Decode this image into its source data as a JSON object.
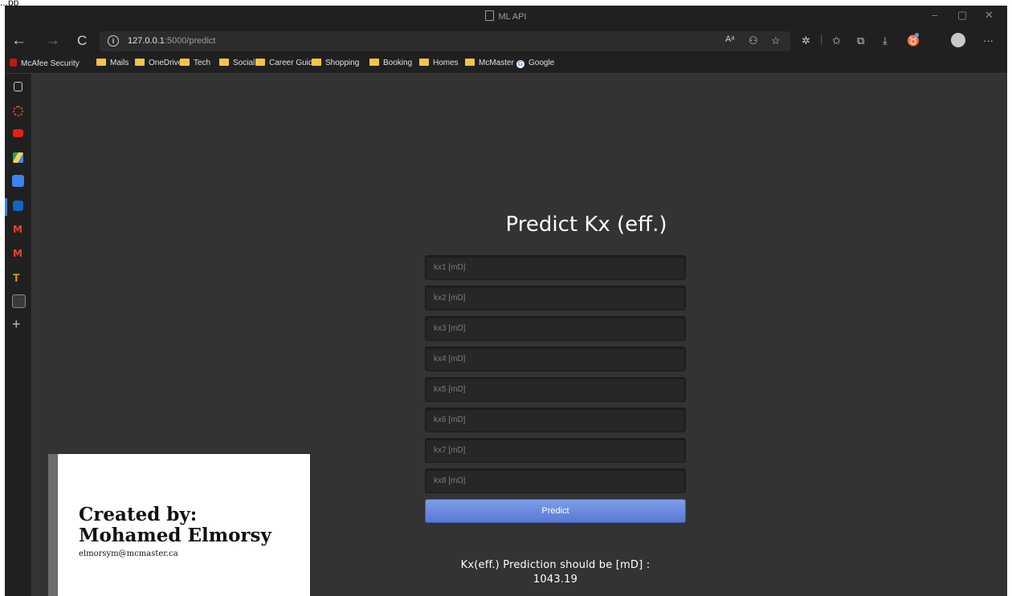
{
  "app_label": "...pp",
  "window": {
    "title": "ML API",
    "minimize": "–",
    "maximize": "▢",
    "close": "✕"
  },
  "toolbar": {
    "back": "←",
    "forward": "→",
    "refresh": "C",
    "info": "i",
    "url_host": "127.0.0.1",
    "url_path": ":5000/predict",
    "read_aloud": "Aᵃ",
    "more": "···"
  },
  "bookmarks": [
    {
      "label": "McAfee Security",
      "icon": "mcafee-icon"
    },
    {
      "label": "Mails",
      "icon": "folder-icon"
    },
    {
      "label": "OneDrive",
      "icon": "folder-icon"
    },
    {
      "label": "Tech",
      "icon": "folder-icon"
    },
    {
      "label": "Social",
      "icon": "folder-icon"
    },
    {
      "label": "Career Guide",
      "icon": "folder-icon"
    },
    {
      "label": "Shopping",
      "icon": "folder-icon"
    },
    {
      "label": "Booking",
      "icon": "folder-icon"
    },
    {
      "label": "Homes",
      "icon": "folder-icon"
    },
    {
      "label": "McMaster",
      "icon": "folder-icon"
    },
    {
      "label": "Google",
      "icon": "google-icon"
    }
  ],
  "sidebar_plus": "+",
  "page": {
    "heading": "Predict Kx (eff.)",
    "fields": [
      {
        "placeholder": "kx1 [mD]"
      },
      {
        "placeholder": "kx2 [mD]"
      },
      {
        "placeholder": "kx3 [mD]"
      },
      {
        "placeholder": "kx4 [mD]"
      },
      {
        "placeholder": "kx5 [mD]"
      },
      {
        "placeholder": "kx6 [mD]"
      },
      {
        "placeholder": "kx7 [mD]"
      },
      {
        "placeholder": "kx8 [mD]"
      }
    ],
    "button_label": "Predict",
    "result_text": "Kx(eff.) Prediction should be [mD] :",
    "result_value": "1043.19"
  },
  "creator": {
    "line1": "Created by:",
    "line2": "Mohamed Elmorsy",
    "email": "elmorsym@mcmaster.ca"
  },
  "colors": {
    "accent": "#6d8ce0",
    "background": "#333333",
    "chrome": "#202020"
  }
}
